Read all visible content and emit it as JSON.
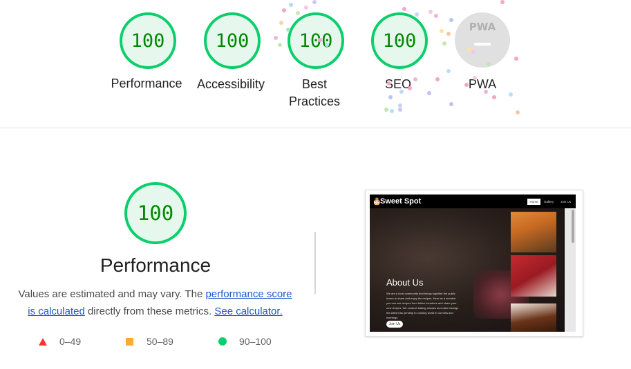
{
  "scores": [
    {
      "label": "Performance",
      "value": "100"
    },
    {
      "label": "Accessibility",
      "value": "100"
    },
    {
      "label": "Best Practices",
      "value": "100",
      "label_line1": "Best",
      "label_line2": "Practices"
    },
    {
      "label": "SEO",
      "value": "100"
    }
  ],
  "pwa": {
    "label": "PWA",
    "badge": "PWA"
  },
  "detail": {
    "score": "100",
    "title": "Performance",
    "desc_prefix": "Values are estimated and may vary. The ",
    "link_score": "performance score is calculated",
    "desc_mid": " directly from these metrics. ",
    "link_calc": "See calculator."
  },
  "legend": [
    {
      "range": "0–49",
      "color": "#ff3333"
    },
    {
      "range": "50–89",
      "color": "#ffaa33"
    },
    {
      "range": "90–100",
      "color": "#0cce6b"
    }
  ],
  "preview": {
    "brand": "Sweet Spot",
    "nav": [
      "Home",
      "Gallery",
      "Join Us"
    ],
    "heading": "About Us",
    "body": "We are a local community that brings together the public lovers to share and enjoy the recipes. Here as a member you can see recipes from fellow members and share your new recipes. We conduct baking classes and cake tastings the latest has pending to cooking world in our fairs and meetings.",
    "button": "Join Us"
  },
  "colors": {
    "pass": "#0cce6b",
    "pass_text": "#008800",
    "pass_bg": "#e6f8ee",
    "link": "#1a57c9"
  }
}
